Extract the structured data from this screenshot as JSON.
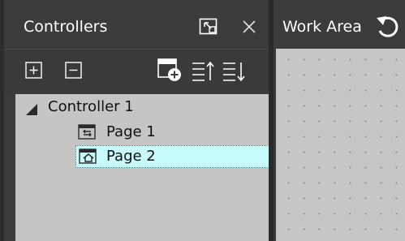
{
  "controllers_panel": {
    "title": "Controllers",
    "restore_icon": "restore-window-icon",
    "close_icon": "close-icon",
    "toolbar": {
      "buttons": [
        {
          "name": "expand-all-button",
          "icon": "plus-box-icon"
        },
        {
          "name": "collapse-all-button",
          "icon": "minus-box-icon"
        },
        {
          "name": "add-page-button",
          "icon": "add-page-icon"
        },
        {
          "name": "move-up-button",
          "icon": "sort-up-icon"
        },
        {
          "name": "move-down-button",
          "icon": "sort-down-icon"
        }
      ]
    },
    "tree": {
      "controller": {
        "label": "Controller 1",
        "expanded": true
      },
      "pages": [
        {
          "label": "Page 1",
          "icon": "link-page-icon",
          "selected": false
        },
        {
          "label": "Page 2",
          "icon": "home-page-icon",
          "selected": true
        }
      ]
    }
  },
  "work_area": {
    "title": "Work Area",
    "undo_icon": "undo-icon"
  },
  "colors": {
    "header_bg": "#3b3b3b",
    "tree_bg": "#c5c5c5",
    "selection": "#c8fbfb",
    "work_area_bg": "#c6c6c6"
  }
}
